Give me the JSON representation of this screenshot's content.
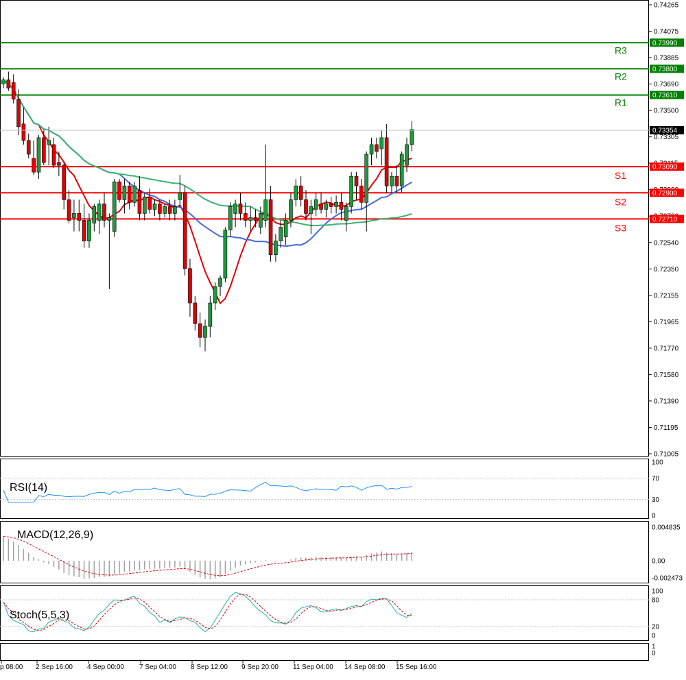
{
  "chart_data": {
    "type": "candlestick",
    "price_axis": {
      "ylim": [
        0.71005,
        0.74265
      ],
      "ticks": [
        "0.74265",
        "0.74075",
        "0.73885",
        "0.73690",
        "0.73500",
        "0.73305",
        "0.73115",
        "0.72920",
        "0.72730",
        "0.72540",
        "0.72350",
        "0.72155",
        "0.71965",
        "0.71770",
        "0.71580",
        "0.71390",
        "0.71195",
        "0.71005"
      ]
    },
    "current_price": "0.73354",
    "levels": [
      {
        "label": "R3",
        "value": 0.7399,
        "tag": "0.73990",
        "color": "#008000"
      },
      {
        "label": "R2",
        "value": 0.738,
        "tag": "0.73800",
        "color": "#008000"
      },
      {
        "label": "R1",
        "value": 0.7361,
        "tag": "0.73610",
        "color": "#008000"
      },
      {
        "label": "S1",
        "value": 0.7309,
        "tag": "0.73090",
        "color": "#ff0000"
      },
      {
        "label": "S2",
        "value": 0.729,
        "tag": "0.72900",
        "color": "#ff0000"
      },
      {
        "label": "S3",
        "value": 0.7271,
        "tag": "0.72710",
        "color": "#ff0000"
      }
    ],
    "x_ticks": [
      "p 08:00",
      "2 Sep 16:00",
      "4 Sep 00:00",
      "7 Sep 04:00",
      "8 Sep 12:00",
      "9 Sep 20:00",
      "11 Sep 04:00",
      "14 Sep 08:00",
      "15 Sep 16:00"
    ],
    "candles": [
      [
        0.7369,
        0.7374,
        0.7366,
        0.7372
      ],
      [
        0.7372,
        0.7378,
        0.7364,
        0.7366
      ],
      [
        0.737,
        0.7376,
        0.7355,
        0.7358
      ],
      [
        0.7358,
        0.7365,
        0.7332,
        0.7338
      ],
      [
        0.734,
        0.7352,
        0.7325,
        0.7328
      ],
      [
        0.7328,
        0.7333,
        0.7315,
        0.7318
      ],
      [
        0.7315,
        0.7328,
        0.7303,
        0.7305
      ],
      [
        0.7305,
        0.7332,
        0.73,
        0.733
      ],
      [
        0.733,
        0.7336,
        0.731,
        0.7312
      ],
      [
        0.7325,
        0.7338,
        0.731,
        0.7328
      ],
      [
        0.7325,
        0.733,
        0.7308,
        0.731
      ],
      [
        0.7312,
        0.732,
        0.7302,
        0.731
      ],
      [
        0.731,
        0.7312,
        0.7278,
        0.7285
      ],
      [
        0.7285,
        0.7292,
        0.7268,
        0.727
      ],
      [
        0.7272,
        0.7285,
        0.7262,
        0.7275
      ],
      [
        0.7275,
        0.7285,
        0.7262,
        0.727
      ],
      [
        0.727,
        0.7282,
        0.725,
        0.7255
      ],
      [
        0.7255,
        0.7275,
        0.725,
        0.727
      ],
      [
        0.7268,
        0.7282,
        0.7262,
        0.728
      ],
      [
        0.727,
        0.7285,
        0.726,
        0.7282
      ],
      [
        0.7282,
        0.729,
        0.7265,
        0.727
      ],
      [
        0.727,
        0.7275,
        0.722,
        0.7272
      ],
      [
        0.7262,
        0.73,
        0.7258,
        0.7298
      ],
      [
        0.7298,
        0.73,
        0.7283,
        0.7285
      ],
      [
        0.7285,
        0.73,
        0.7275,
        0.7295
      ],
      [
        0.7295,
        0.7298,
        0.7278,
        0.7283
      ],
      [
        0.7283,
        0.7298,
        0.728,
        0.7295
      ],
      [
        0.7292,
        0.7302,
        0.727,
        0.7275
      ],
      [
        0.7275,
        0.729,
        0.727,
        0.7287
      ],
      [
        0.7287,
        0.7293,
        0.7275,
        0.7278
      ],
      [
        0.7278,
        0.7285,
        0.7273,
        0.7282
      ],
      [
        0.7282,
        0.7285,
        0.727,
        0.7275
      ],
      [
        0.7275,
        0.7282,
        0.7272,
        0.728
      ],
      [
        0.728,
        0.7285,
        0.727,
        0.7275
      ],
      [
        0.7275,
        0.7285,
        0.727,
        0.728
      ],
      [
        0.7285,
        0.7303,
        0.728,
        0.729
      ],
      [
        0.729,
        0.7295,
        0.723,
        0.7235
      ],
      [
        0.7235,
        0.7242,
        0.72,
        0.721
      ],
      [
        0.721,
        0.7215,
        0.719,
        0.7195
      ],
      [
        0.7195,
        0.7203,
        0.7178,
        0.7185
      ],
      [
        0.7185,
        0.7198,
        0.7175,
        0.7193
      ],
      [
        0.7193,
        0.7215,
        0.7185,
        0.721
      ],
      [
        0.721,
        0.7225,
        0.7205,
        0.7222
      ],
      [
        0.7222,
        0.723,
        0.7215,
        0.7228
      ],
      [
        0.7228,
        0.7265,
        0.7225,
        0.7263
      ],
      [
        0.7263,
        0.7283,
        0.7258,
        0.728
      ],
      [
        0.7275,
        0.7285,
        0.7265,
        0.7282
      ],
      [
        0.7282,
        0.729,
        0.727,
        0.7275
      ],
      [
        0.7275,
        0.7283,
        0.7265,
        0.727
      ],
      [
        0.727,
        0.728,
        0.7262,
        0.7272
      ],
      [
        0.7272,
        0.7278,
        0.7265,
        0.727
      ],
      [
        0.7265,
        0.728,
        0.726,
        0.7275
      ],
      [
        0.727,
        0.7325,
        0.7265,
        0.7285
      ],
      [
        0.7285,
        0.7295,
        0.724,
        0.7245
      ],
      [
        0.7245,
        0.726,
        0.724,
        0.7255
      ],
      [
        0.7255,
        0.727,
        0.725,
        0.7265
      ],
      [
        0.7258,
        0.7275,
        0.7252,
        0.727
      ],
      [
        0.727,
        0.729,
        0.7265,
        0.7285
      ],
      [
        0.7285,
        0.73,
        0.728,
        0.7295
      ],
      [
        0.7295,
        0.7302,
        0.728,
        0.7285
      ],
      [
        0.7285,
        0.7292,
        0.727,
        0.7275
      ],
      [
        0.7275,
        0.7285,
        0.726,
        0.728
      ],
      [
        0.7278,
        0.729,
        0.7273,
        0.7285
      ],
      [
        0.7282,
        0.729,
        0.7275,
        0.7278
      ],
      [
        0.7278,
        0.7285,
        0.7272,
        0.7282
      ],
      [
        0.7282,
        0.7287,
        0.7275,
        0.728
      ],
      [
        0.728,
        0.7288,
        0.7275,
        0.7283
      ],
      [
        0.7283,
        0.729,
        0.727,
        0.7278
      ],
      [
        0.727,
        0.7283,
        0.7262,
        0.728
      ],
      [
        0.728,
        0.7305,
        0.7275,
        0.7302
      ],
      [
        0.7302,
        0.7305,
        0.7285,
        0.7295
      ],
      [
        0.7295,
        0.73,
        0.7278,
        0.7283
      ],
      [
        0.7283,
        0.732,
        0.7262,
        0.7318
      ],
      [
        0.7318,
        0.733,
        0.731,
        0.7325
      ],
      [
        0.7325,
        0.733,
        0.7315,
        0.732
      ],
      [
        0.7322,
        0.7335,
        0.731,
        0.733
      ],
      [
        0.733,
        0.734,
        0.729,
        0.7295
      ],
      [
        0.7295,
        0.7305,
        0.729,
        0.7302
      ],
      [
        0.7302,
        0.731,
        0.729,
        0.7295
      ],
      [
        0.7295,
        0.732,
        0.729,
        0.7318
      ],
      [
        0.731,
        0.733,
        0.7305,
        0.7325
      ],
      [
        0.7325,
        0.7342,
        0.732,
        0.7336
      ]
    ],
    "indicators": [
      {
        "name": "RSI(14)",
        "levels": [
          "100",
          "70",
          "30",
          "0"
        ]
      },
      {
        "name": "MACD(12,26,9)",
        "levels": [
          "0.004835",
          "0.00",
          "-0.002473"
        ]
      },
      {
        "name": "Stoch(5,5,3)",
        "levels": [
          "100",
          "80",
          "20",
          "0"
        ]
      }
    ],
    "empty_panel_levels": [
      "1",
      "0"
    ]
  }
}
